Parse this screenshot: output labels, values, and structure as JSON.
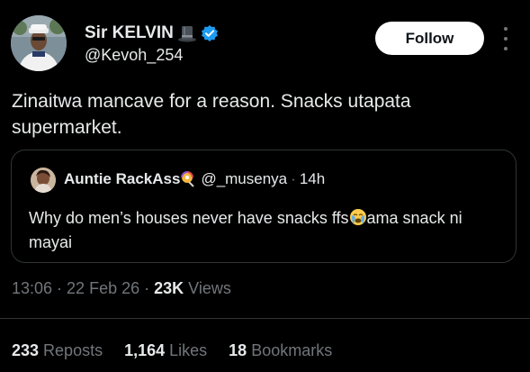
{
  "author": {
    "name": "Sir KELVIN",
    "handle": "@Kevoh_254",
    "follow_label": "Follow"
  },
  "tweet": {
    "text": "Zinaitwa mancave for a reason. Snacks utapata supermarket."
  },
  "quote": {
    "name": "Auntie RackAss",
    "handle": "@_musenya",
    "separator": "·",
    "time": "14h",
    "text_before_emoji": "Why do men’s houses never have snacks ffs",
    "text_after_emoji": "ama snack ni mayai"
  },
  "meta": {
    "time": "13:06",
    "sep1": " · ",
    "date": "22 Feb 26",
    "sep2": " · ",
    "views_count": "23K",
    "views_label": " Views"
  },
  "stats": [
    {
      "count": "233",
      "label": "Reposts"
    },
    {
      "count": "1,164",
      "label": "Likes"
    },
    {
      "count": "18",
      "label": "Bookmarks"
    }
  ],
  "colors": {
    "background": "#000000",
    "text_primary": "#e7e9ea",
    "text_secondary": "#71767b",
    "border": "#2f3336",
    "verified_blue": "#1d9bf0",
    "follow_bg": "#ffffff"
  },
  "icons": {
    "verified": "verified-badge-icon",
    "hat": "top-hat-emoji",
    "lollipop": "lollipop-emoji",
    "crying": "loudly-crying-face-emoji",
    "more": "more-options-icon"
  }
}
